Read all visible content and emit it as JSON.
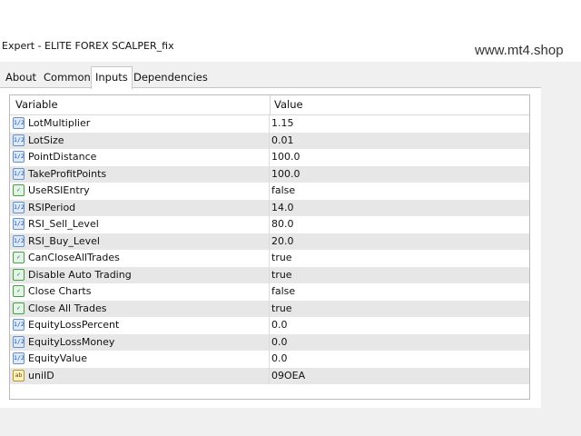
{
  "window": {
    "title": "Expert - ELITE FOREX SCALPER_fix",
    "watermark": "www.mt4.shop"
  },
  "tabs": [
    {
      "label": "About",
      "active": false
    },
    {
      "label": "Common",
      "active": false
    },
    {
      "label": "Inputs",
      "active": true
    },
    {
      "label": "Dependencies",
      "active": false
    }
  ],
  "grid": {
    "columns": {
      "variable": "Variable",
      "value": "Value"
    },
    "rows": [
      {
        "name": "LotMultiplier",
        "value": "1.15",
        "icon": "numeric-icon"
      },
      {
        "name": "LotSize",
        "value": "0.01",
        "icon": "numeric-icon"
      },
      {
        "name": "PointDistance",
        "value": "100.0",
        "icon": "numeric-icon"
      },
      {
        "name": "TakeProfitPoints",
        "value": "100.0",
        "icon": "numeric-icon"
      },
      {
        "name": "UseRSIEntry",
        "value": "false",
        "icon": "boolean-icon"
      },
      {
        "name": "RSIPeriod",
        "value": "14.0",
        "icon": "numeric-icon"
      },
      {
        "name": "RSI_Sell_Level",
        "value": "80.0",
        "icon": "numeric-icon"
      },
      {
        "name": "RSI_Buy_Level",
        "value": "20.0",
        "icon": "numeric-icon"
      },
      {
        "name": "CanCloseAllTrades",
        "value": "true",
        "icon": "boolean-icon"
      },
      {
        "name": "Disable Auto Trading",
        "value": "true",
        "icon": "boolean-icon"
      },
      {
        "name": "Close Charts",
        "value": "false",
        "icon": "boolean-icon"
      },
      {
        "name": "Close All Trades",
        "value": "true",
        "icon": "boolean-icon"
      },
      {
        "name": "EquityLossPercent",
        "value": "0.0",
        "icon": "numeric-icon"
      },
      {
        "name": "EquityLossMoney",
        "value": "0.0",
        "icon": "numeric-icon"
      },
      {
        "name": "EquityValue",
        "value": "0.0",
        "icon": "numeric-icon"
      },
      {
        "name": "uniID",
        "value": "09OEA",
        "icon": "string-icon"
      }
    ]
  }
}
